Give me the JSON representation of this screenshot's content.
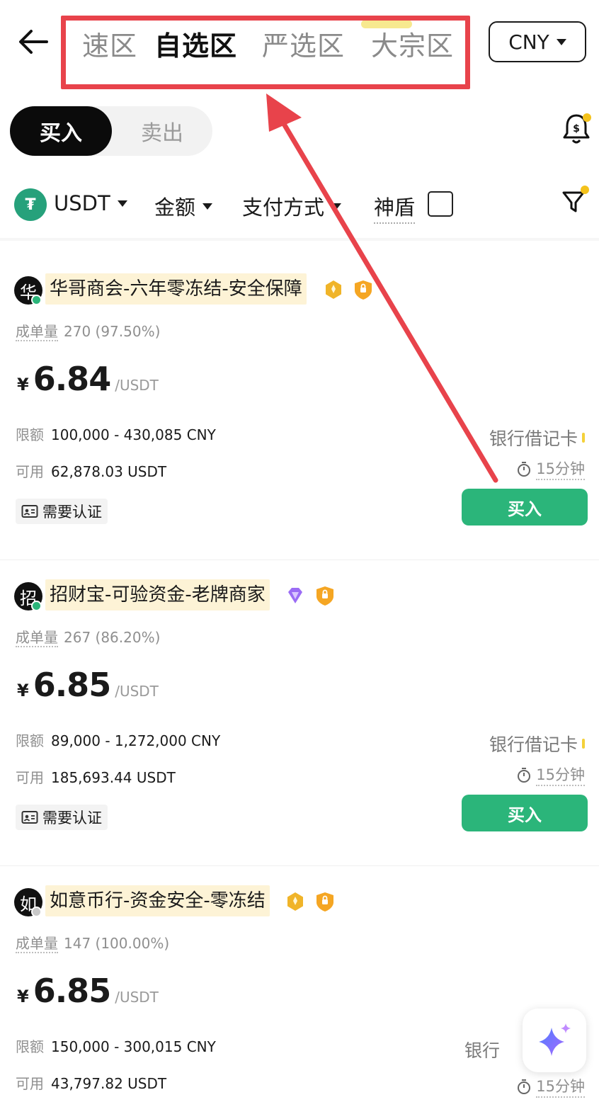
{
  "header": {
    "back_icon": "arrow-left-icon",
    "tabs": [
      {
        "label": "速区",
        "active": false
      },
      {
        "label": "自选区",
        "active": true
      },
      {
        "label": "严选区",
        "active": false
      },
      {
        "label": "大宗区",
        "active": false
      }
    ],
    "currency": "CNY"
  },
  "trade_toggle": {
    "buy": "买入",
    "sell": "卖出"
  },
  "filters": {
    "coin": "USDT",
    "coin_logo_glyph": "₮",
    "amount": "金额",
    "payment": "支付方式",
    "shield": "神盾"
  },
  "listings": [
    {
      "avatar_char": "华",
      "online": true,
      "merchant": "华哥商会-六年零冻结-安全保障",
      "merchant_badge": "gold-badge",
      "orders_label": "成单量",
      "orders": "270 (97.50%)",
      "currency_symbol": "¥",
      "price": "6.84",
      "unit": "/USDT",
      "limit_label": "限额",
      "limit": "100,000 - 430,085 CNY",
      "available_label": "可用",
      "available": "62,878.03 USDT",
      "verify": "需要认证",
      "payment": "银行借记卡",
      "time": "15分钟",
      "action": "买入"
    },
    {
      "avatar_char": "招",
      "online": true,
      "merchant": "招财宝-可验资金-老牌商家",
      "merchant_badge": "diamond-badge",
      "orders_label": "成单量",
      "orders": "267 (86.20%)",
      "currency_symbol": "¥",
      "price": "6.85",
      "unit": "/USDT",
      "limit_label": "限额",
      "limit": "89,000 - 1,272,000 CNY",
      "available_label": "可用",
      "available": "185,693.44 USDT",
      "verify": "需要认证",
      "payment": "银行借记卡",
      "time": "15分钟",
      "action": "买入"
    },
    {
      "avatar_char": "如",
      "online": false,
      "merchant": "如意币行-资金安全-零冻结",
      "merchant_badge": "gold-badge",
      "orders_label": "成单量",
      "orders": "147 (100.00%)",
      "currency_symbol": "¥",
      "price": "6.85",
      "unit": "/USDT",
      "limit_label": "限额",
      "limit": "150,000 - 300,015 CNY",
      "available_label": "可用",
      "available": "43,797.82 USDT",
      "payment": "银行",
      "time": "15分钟"
    }
  ],
  "colors": {
    "accent_green": "#2bb57a",
    "annotation_red": "#e8434b",
    "merchant_highlight": "#fdf3d6",
    "badge_orange": "#f5a623"
  }
}
